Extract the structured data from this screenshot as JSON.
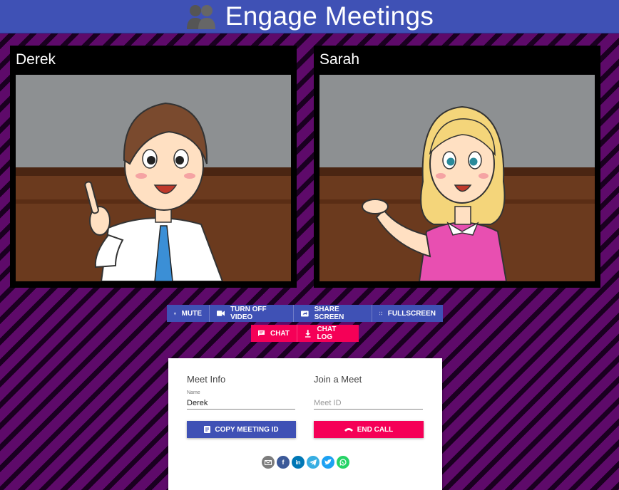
{
  "header": {
    "title": "Engage Meetings",
    "logo": "two-people-icon"
  },
  "videos": [
    {
      "name": "Derek"
    },
    {
      "name": "Sarah"
    }
  ],
  "controls": {
    "mute": "MUTE",
    "video": "TURN OFF VIDEO",
    "share": "SHARE SCREEN",
    "fullscreen": "FULLSCREEN",
    "chat": "CHAT",
    "chatlog": "CHAT LOG"
  },
  "meet_info": {
    "heading": "Meet Info",
    "name_label": "Name",
    "name_value": "Derek",
    "copy_button": "COPY MEETING ID"
  },
  "join": {
    "heading": "Join a Meet",
    "placeholder": "Meet ID",
    "end_button": "END CALL"
  },
  "social": [
    "email-icon",
    "facebook-icon",
    "linkedin-icon",
    "telegram-icon",
    "twitter-icon",
    "whatsapp-icon"
  ],
  "colors": {
    "primary": "#3f51b5",
    "accent": "#f50057"
  }
}
